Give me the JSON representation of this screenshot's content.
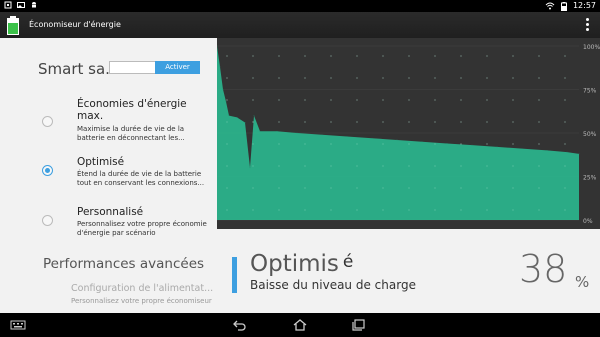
{
  "status_bar": {
    "time": "12:57",
    "icons": [
      "notification-icon",
      "image-icon",
      "android-icon",
      "wifi-icon",
      "battery-icon"
    ]
  },
  "app": {
    "title": "Économiseur d'énergie",
    "icon": "battery-icon"
  },
  "smart_saver": {
    "label": "Smart sa..",
    "input_value": "",
    "button_label": "Activer"
  },
  "options": [
    {
      "title": "Économies d'énergie max.",
      "description": "Maximise la durée de vie de la batterie en déconnectant les...",
      "selected": false
    },
    {
      "title": "Optimisé",
      "description": "Étend la durée de vie de la batterie tout en conservant les connexions...",
      "selected": true
    },
    {
      "title": "Personnalisé",
      "description": "Personnalisez votre propre économie d'énergie par scénario",
      "selected": false
    }
  ],
  "advanced": {
    "title": "Performances avancées",
    "config_title": "Configuration de l'alimentat...",
    "config_desc": "Personnalisez votre propre économiseur"
  },
  "summary": {
    "mode": "Optimis",
    "mode_suffix": "é",
    "label": "Baisse du niveau de charge",
    "percent": "38",
    "percent_sign": "%"
  },
  "colors": {
    "accent": "#3d9fe0",
    "chart_fill": "#2bb28b",
    "chart_bg": "#333333"
  },
  "chart_data": {
    "type": "area",
    "y_ticks": [
      "100%",
      "75%",
      "50%",
      "25%",
      "0%"
    ],
    "ylim": [
      0,
      100
    ],
    "grid": true,
    "series": [
      {
        "values": [
          100,
          88,
          75,
          68,
          60,
          59,
          56,
          30,
          60,
          51,
          51,
          50,
          49,
          48,
          47,
          46,
          45,
          44,
          43,
          42,
          41,
          40,
          39,
          38
        ]
      }
    ]
  },
  "navbar": {
    "icons": [
      "keyboard-icon",
      "back-icon",
      "home-icon",
      "recents-icon"
    ]
  }
}
